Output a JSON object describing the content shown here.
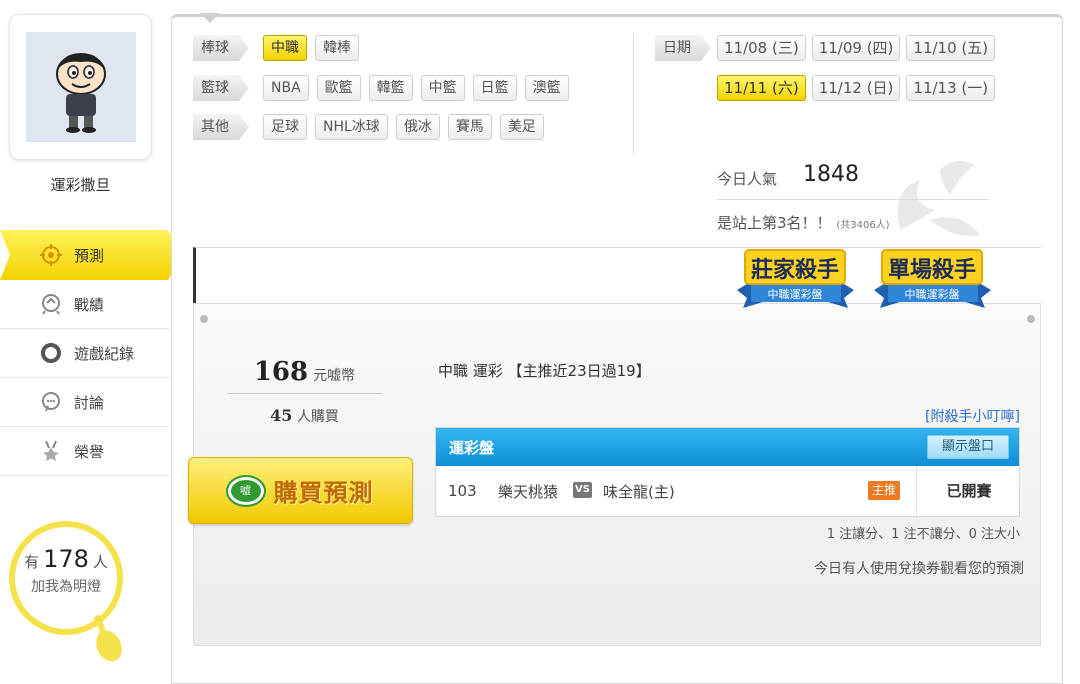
{
  "profile": {
    "username": "運彩撒旦"
  },
  "nav": {
    "items": [
      {
        "label": "預測",
        "icon": "target-icon",
        "active": true
      },
      {
        "label": "戰績",
        "icon": "record-icon",
        "active": false
      },
      {
        "label": "遊戲紀錄",
        "icon": "ring-icon",
        "active": false
      },
      {
        "label": "討論",
        "icon": "chat-icon",
        "active": false
      },
      {
        "label": "榮譽",
        "icon": "medal-icon",
        "active": false
      }
    ]
  },
  "lamp": {
    "prefix": "有",
    "count": "178",
    "suffix": "人",
    "caption": "加我為明燈"
  },
  "categories": [
    {
      "label": "棒球",
      "items": [
        {
          "label": "中職",
          "selected": true
        },
        {
          "label": "韓棒",
          "selected": false
        }
      ]
    },
    {
      "label": "籃球",
      "items": [
        {
          "label": "NBA"
        },
        {
          "label": "歐籃"
        },
        {
          "label": "韓籃"
        },
        {
          "label": "中籃"
        },
        {
          "label": "日籃"
        },
        {
          "label": "澳籃"
        }
      ]
    },
    {
      "label": "其他",
      "items": [
        {
          "label": "足球"
        },
        {
          "label": "NHL冰球"
        },
        {
          "label": "俄冰"
        },
        {
          "label": "賽馬"
        },
        {
          "label": "美足"
        }
      ]
    }
  ],
  "dates": {
    "label": "日期",
    "row1": [
      {
        "label": "11/08 (三)"
      },
      {
        "label": "11/09 (四)"
      },
      {
        "label": "11/10 (五)"
      }
    ],
    "row2": [
      {
        "label": "11/11 (六)",
        "selected": true
      },
      {
        "label": "11/12 (日)"
      },
      {
        "label": "11/13 (一)"
      }
    ]
  },
  "popularity": {
    "label": "今日人氣",
    "value": "1848",
    "rank_text": "是站上第3名！！",
    "rank_note": "(共3406人)"
  },
  "badges": [
    {
      "title": "莊家殺手",
      "subtitle": "中職運彩盤"
    },
    {
      "title": "單場殺手",
      "subtitle": "中職運彩盤"
    }
  ],
  "offer": {
    "price": "168",
    "price_unit": "元嘘幣",
    "buyers": "45",
    "buyers_unit": "人購買",
    "buy_label": "購買預測",
    "seal_text": "嘘"
  },
  "recommend": {
    "title": "中職 運彩 【主推近23日過19】",
    "killer_tip": "[附殺手小叮嚀]",
    "table_header": "運彩盤",
    "show_button": "顯示盤口",
    "game": {
      "no": "103",
      "away": "樂天桃猿",
      "vs": "VS",
      "home": "味全龍(主)",
      "pick": "主推",
      "status": "已開賽"
    },
    "handicap_summary": "1 注讓分、1 注不讓分、0 注大小",
    "voucher_note": "今日有人使用兌換券觀看您的預測"
  },
  "colors": {
    "accent_yellow": "#f3d200",
    "header_blue": "#0f90d8",
    "link_blue": "#2a70c8",
    "pick_orange": "#f07a20"
  }
}
